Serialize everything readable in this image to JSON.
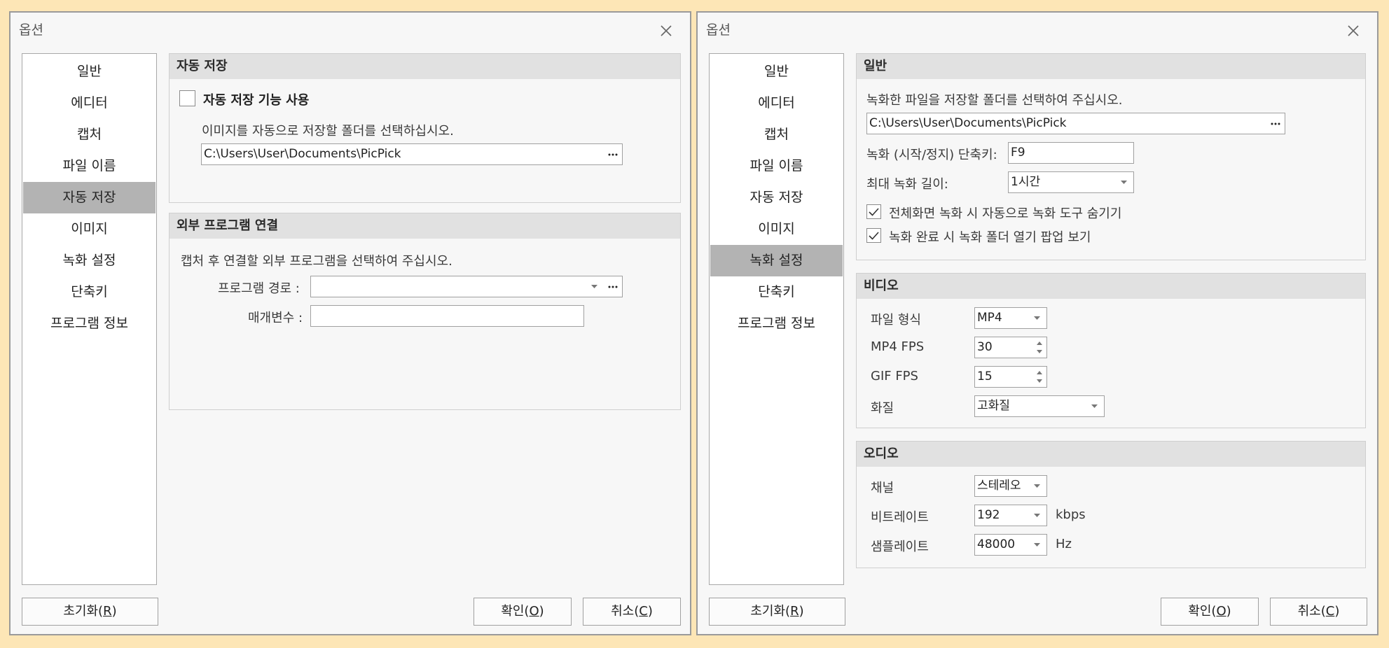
{
  "left": {
    "title": "옵션",
    "nav": [
      "일반",
      "에디터",
      "캡처",
      "파일 이름",
      "자동 저장",
      "이미지",
      "녹화 설정",
      "단축키",
      "프로그램 정보"
    ],
    "auto_save": {
      "header": "자동 저장",
      "checkbox_label": "자동 저장 기능 사용",
      "checked": false,
      "description": "이미지를 자동으로 저장할 폴더를 선택하십시오.",
      "path": "C:\\Users\\User\\Documents\\PicPick"
    },
    "external": {
      "header": "외부 프로그램 연결",
      "description": "캡처 후 연결할 외부 프로그램을 선택하여 주십시오.",
      "program_path_label": "프로그램 경로 :",
      "program_path_value": "",
      "params_label": "매개변수 :",
      "params_value": ""
    },
    "buttons": {
      "reset": "초기화(",
      "reset_mn": "R",
      "ok": "확인(",
      "ok_mn": "O",
      "cancel": "취소(",
      "cancel_mn": "C",
      "close_paren": ")"
    }
  },
  "right": {
    "title": "옵션",
    "nav": [
      "일반",
      "에디터",
      "캡처",
      "파일 이름",
      "자동 저장",
      "이미지",
      "녹화 설정",
      "단축키",
      "프로그램 정보"
    ],
    "general": {
      "header": "일반",
      "description": "녹화한 파일을 저장할 폴더를 선택하여 주십시오.",
      "path": "C:\\Users\\User\\Documents\\PicPick",
      "hotkey_label": "녹화 (시작/정지) 단축키:",
      "hotkey_value": "F9",
      "max_length_label": "최대 녹화 길이:",
      "max_length_value": "1시간",
      "hide_tools_label": "전체화면 녹화 시 자동으로 녹화 도구 숨기기",
      "hide_tools_checked": true,
      "open_popup_label": "녹화 완료 시 녹화 폴더 열기 팝업 보기",
      "open_popup_checked": true
    },
    "video": {
      "header": "비디오",
      "format_label": "파일 형식",
      "format_value": "MP4",
      "mp4fps_label": "MP4 FPS",
      "mp4fps_value": "30",
      "giffps_label": "GIF FPS",
      "giffps_value": "15",
      "quality_label": "화질",
      "quality_value": "고화질"
    },
    "audio": {
      "header": "오디오",
      "channel_label": "채널",
      "channel_value": "스테레오",
      "bitrate_label": "비트레이트",
      "bitrate_value": "192",
      "bitrate_unit": "kbps",
      "samplerate_label": "샘플레이트",
      "samplerate_value": "48000",
      "samplerate_unit": "Hz"
    },
    "buttons": {
      "reset": "초기화(",
      "reset_mn": "R",
      "ok": "확인(",
      "ok_mn": "O",
      "cancel": "취소(",
      "cancel_mn": "C",
      "close_paren": ")"
    }
  },
  "colors": {
    "background": "#fde6b6",
    "dialog": "#f7f7f7",
    "nav_active": "#b3b3b3",
    "group_header": "#e1e1e1"
  }
}
